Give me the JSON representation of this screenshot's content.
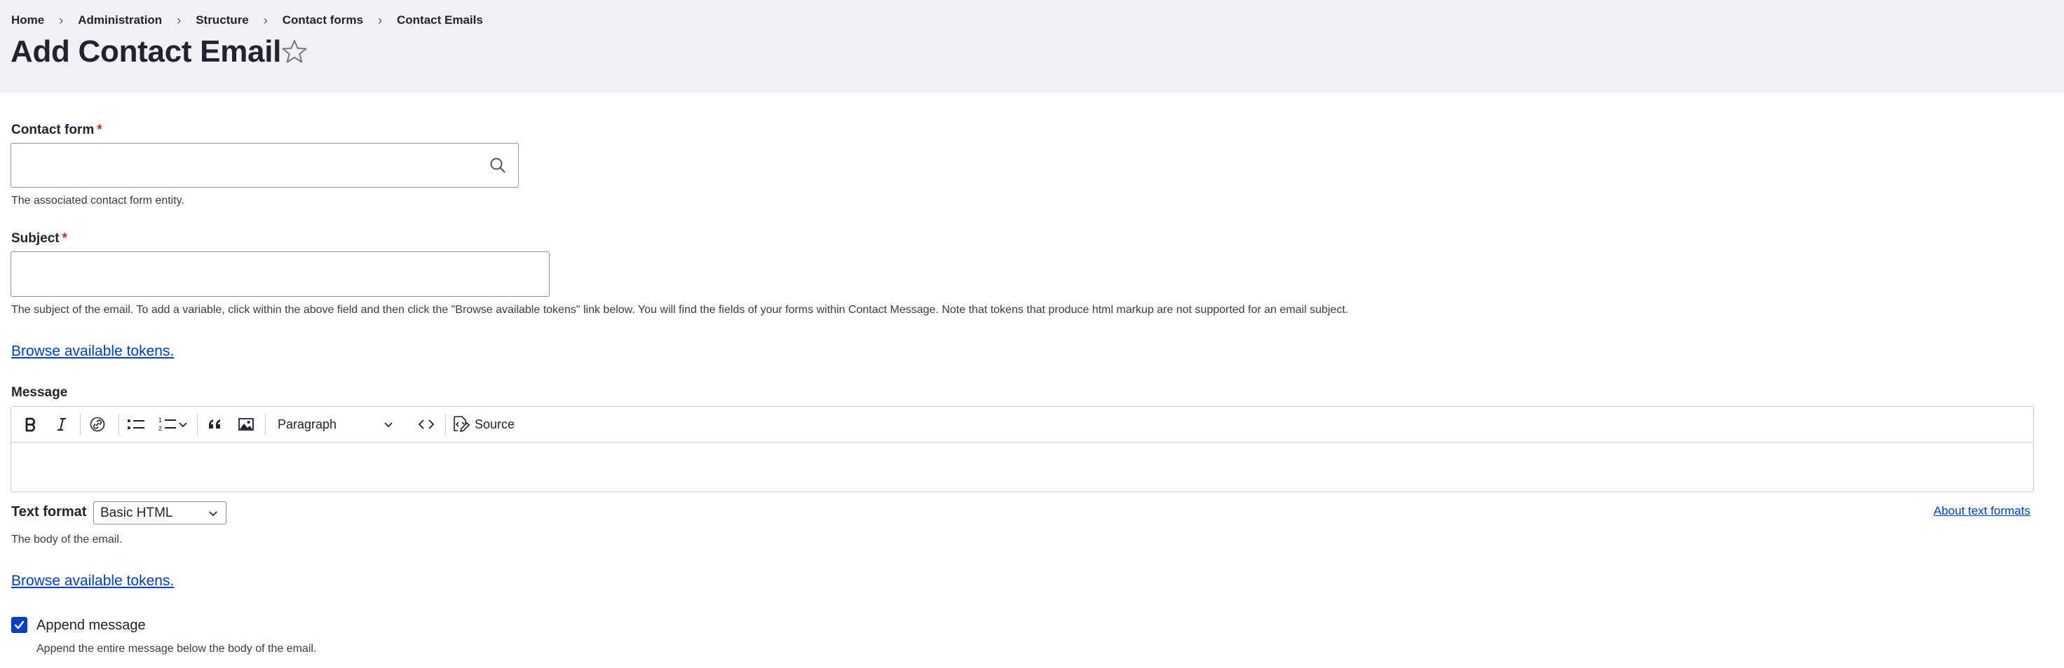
{
  "breadcrumb": {
    "items": [
      "Home",
      "Administration",
      "Structure",
      "Contact forms",
      "Contact Emails"
    ],
    "separator": "›"
  },
  "page": {
    "title": "Add Contact Email"
  },
  "contact_form": {
    "label": "Contact form",
    "required_mark": "*",
    "value": "",
    "description": "The associated contact form entity."
  },
  "subject": {
    "label": "Subject",
    "required_mark": "*",
    "value": "",
    "description": "The subject of the email. To add a variable, click within the above field and then click the \"Browse available tokens\" link below. You will find the fields of your forms within Contact Message. Note that tokens that produce html markup are not supported for an email subject."
  },
  "tokens_link": "Browse available tokens.",
  "message": {
    "label": "Message",
    "toolbar": {
      "heading_select": "Paragraph",
      "source_label": "Source",
      "icons": [
        "bold-icon",
        "italic-icon",
        "link-icon",
        "bulleted-list-icon",
        "numbered-list-icon",
        "blockquote-icon",
        "image-icon",
        "code-icon",
        "source-icon"
      ]
    },
    "text_format_label": "Text format",
    "text_format_value": "Basic HTML",
    "about_formats_link": "About text formats",
    "description": "The body of the email."
  },
  "append_message": {
    "label": "Append message",
    "checked": true,
    "description": "Append the entire message below the body of the email."
  },
  "colors": {
    "header_bg": "#f0f1f5",
    "link": "#003ecc",
    "required": "#dc2323",
    "checkbox": "#003ecc"
  }
}
